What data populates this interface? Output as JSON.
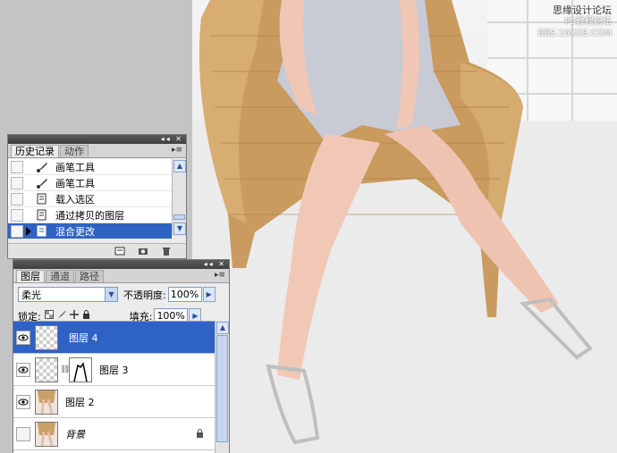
{
  "watermark": {
    "line1": "思缘设计论坛",
    "line2": "PS教程论坛",
    "line3": "BBS.16XX8.COM"
  },
  "history_panel": {
    "tabs": [
      "历史记录",
      "动作"
    ],
    "items": [
      {
        "label": "画笔工具",
        "icon": "brush-icon"
      },
      {
        "label": "画笔工具",
        "icon": "brush-icon"
      },
      {
        "label": "载入选区",
        "icon": "document-icon"
      },
      {
        "label": "通过拷贝的图层",
        "icon": "document-icon"
      },
      {
        "label": "混合更改",
        "icon": "document-icon",
        "selected": true
      }
    ],
    "footer_icons": [
      "new-document-from-state-icon",
      "snapshot-camera-icon",
      "trash-icon"
    ]
  },
  "layers_panel": {
    "tabs": [
      "图层",
      "通道",
      "路径"
    ],
    "blend_mode": "柔光",
    "opacity_label": "不透明度:",
    "opacity_value": "100%",
    "lock_label": "锁定:",
    "lock_icons": [
      "lock-transparent-icon",
      "lock-paint-icon",
      "lock-move-icon",
      "lock-all-icon"
    ],
    "fill_label": "填充:",
    "fill_value": "100%",
    "layers": [
      {
        "name": "图层 4",
        "visible": true,
        "selected": true,
        "thumb": "transparent"
      },
      {
        "name": "图层 3",
        "visible": true,
        "selected": false,
        "thumb": "transparent",
        "mask": true
      },
      {
        "name": "图层 2",
        "visible": true,
        "selected": false,
        "thumb": "image"
      },
      {
        "name": "背景",
        "visible": false,
        "selected": false,
        "thumb": "image",
        "locked": true
      }
    ]
  },
  "colors": {
    "selection": "#2f63c3",
    "panel_bg": "#ececec",
    "titlebar": "#4a4a4a"
  }
}
